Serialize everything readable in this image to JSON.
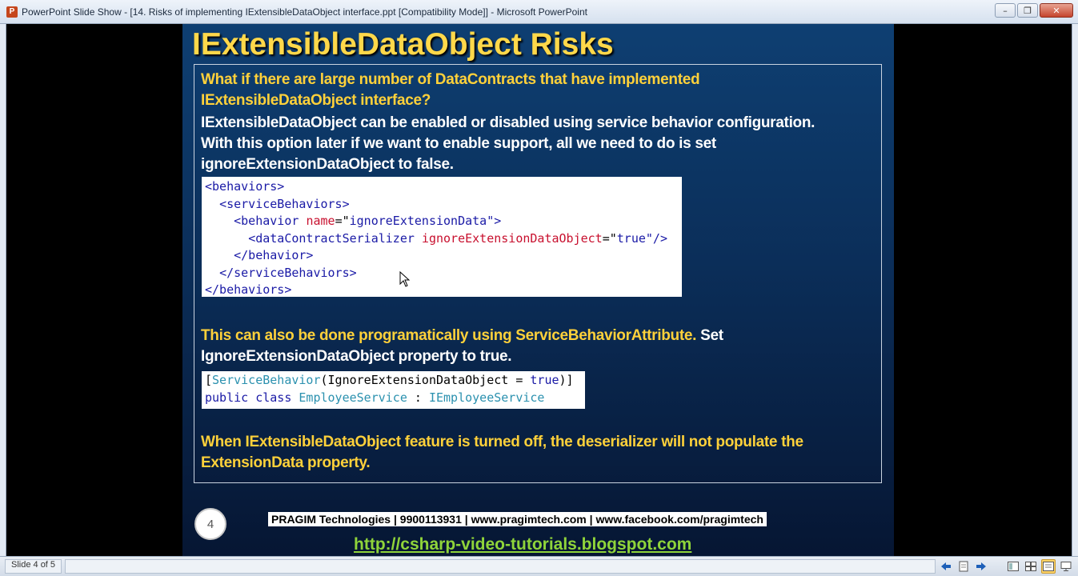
{
  "window": {
    "app_icon": "P",
    "title": "PowerPoint Slide Show - [14. Risks of implementing IExtensibleDataObject interface.ppt [Compatibility Mode]] - Microsoft PowerPoint",
    "minimize_icon": "–",
    "maximize_icon": "❐",
    "close_icon": "✕"
  },
  "slide": {
    "title": "IExtensibleDataObject Risks",
    "question_line1": "What if there are large number of DataContracts that have implemented",
    "question_line2": "IExtensibleDataObject interface?",
    "answer_line1": "IExtensibleDataObject can be enabled or disabled using service behavior configuration.",
    "answer_line2": "With this option later if we want to enable support, all we need to do is set",
    "answer_line3": "ignoreExtensionDataObject to false.",
    "config_code": {
      "l1_tag": "<behaviors>",
      "l2_tag": "<serviceBehaviors>",
      "l3_open": "<behavior ",
      "l3_attr": "name",
      "l3_eq": "=\"",
      "l3_val": "ignoreExtensionData",
      "l3_close": "\">",
      "l4_open": "<dataContractSerializer ",
      "l4_attr": "ignoreExtensionDataObject",
      "l4_eq": "=\"",
      "l4_val": "true",
      "l4_close": "\"/>",
      "l5_tag": "</behavior>",
      "l6_tag": "</serviceBehaviors>",
      "l7_tag": "</behaviors>"
    },
    "prog_part1": "This can also be done programatically using ServiceBehaviorAttribute.",
    "prog_part2": " Set",
    "prog_line2": "IgnoreExtensionDataObject property to true.",
    "attr_code": {
      "l1_open": "[",
      "l1_type": "ServiceBehavior",
      "l1_mid": "(IgnoreExtensionDataObject = ",
      "l1_kw": "true",
      "l1_close": ")]",
      "l2_kw": "public class ",
      "l2_type": "EmployeeService",
      "l2_sep": " : ",
      "l2_iface": "IEmployeeService"
    },
    "conclusion_line1": "When IExtensibleDataObject feature is turned off, the deserializer will not populate the",
    "conclusion_line2": "ExtensionData property.",
    "slide_number": "4",
    "footer": "PRAGIM Technologies | 9900113931 | www.pragimtech.com | www.facebook.com/pragimtech",
    "blog_link": "http://csharp-video-tutorials.blogspot.com"
  },
  "statusbar": {
    "slide_indicator": "Slide 4 of 5",
    "tools": [
      "prev-icon",
      "notes-icon",
      "next-icon",
      "normal-view-icon",
      "slide-sorter-icon",
      "reading-view-icon",
      "slideshow-icon"
    ]
  },
  "colors": {
    "title": "#ffd84a",
    "highlight_text": "#ffd13a",
    "slide_bg": "#0b2e59",
    "link": "#8fd43a"
  }
}
